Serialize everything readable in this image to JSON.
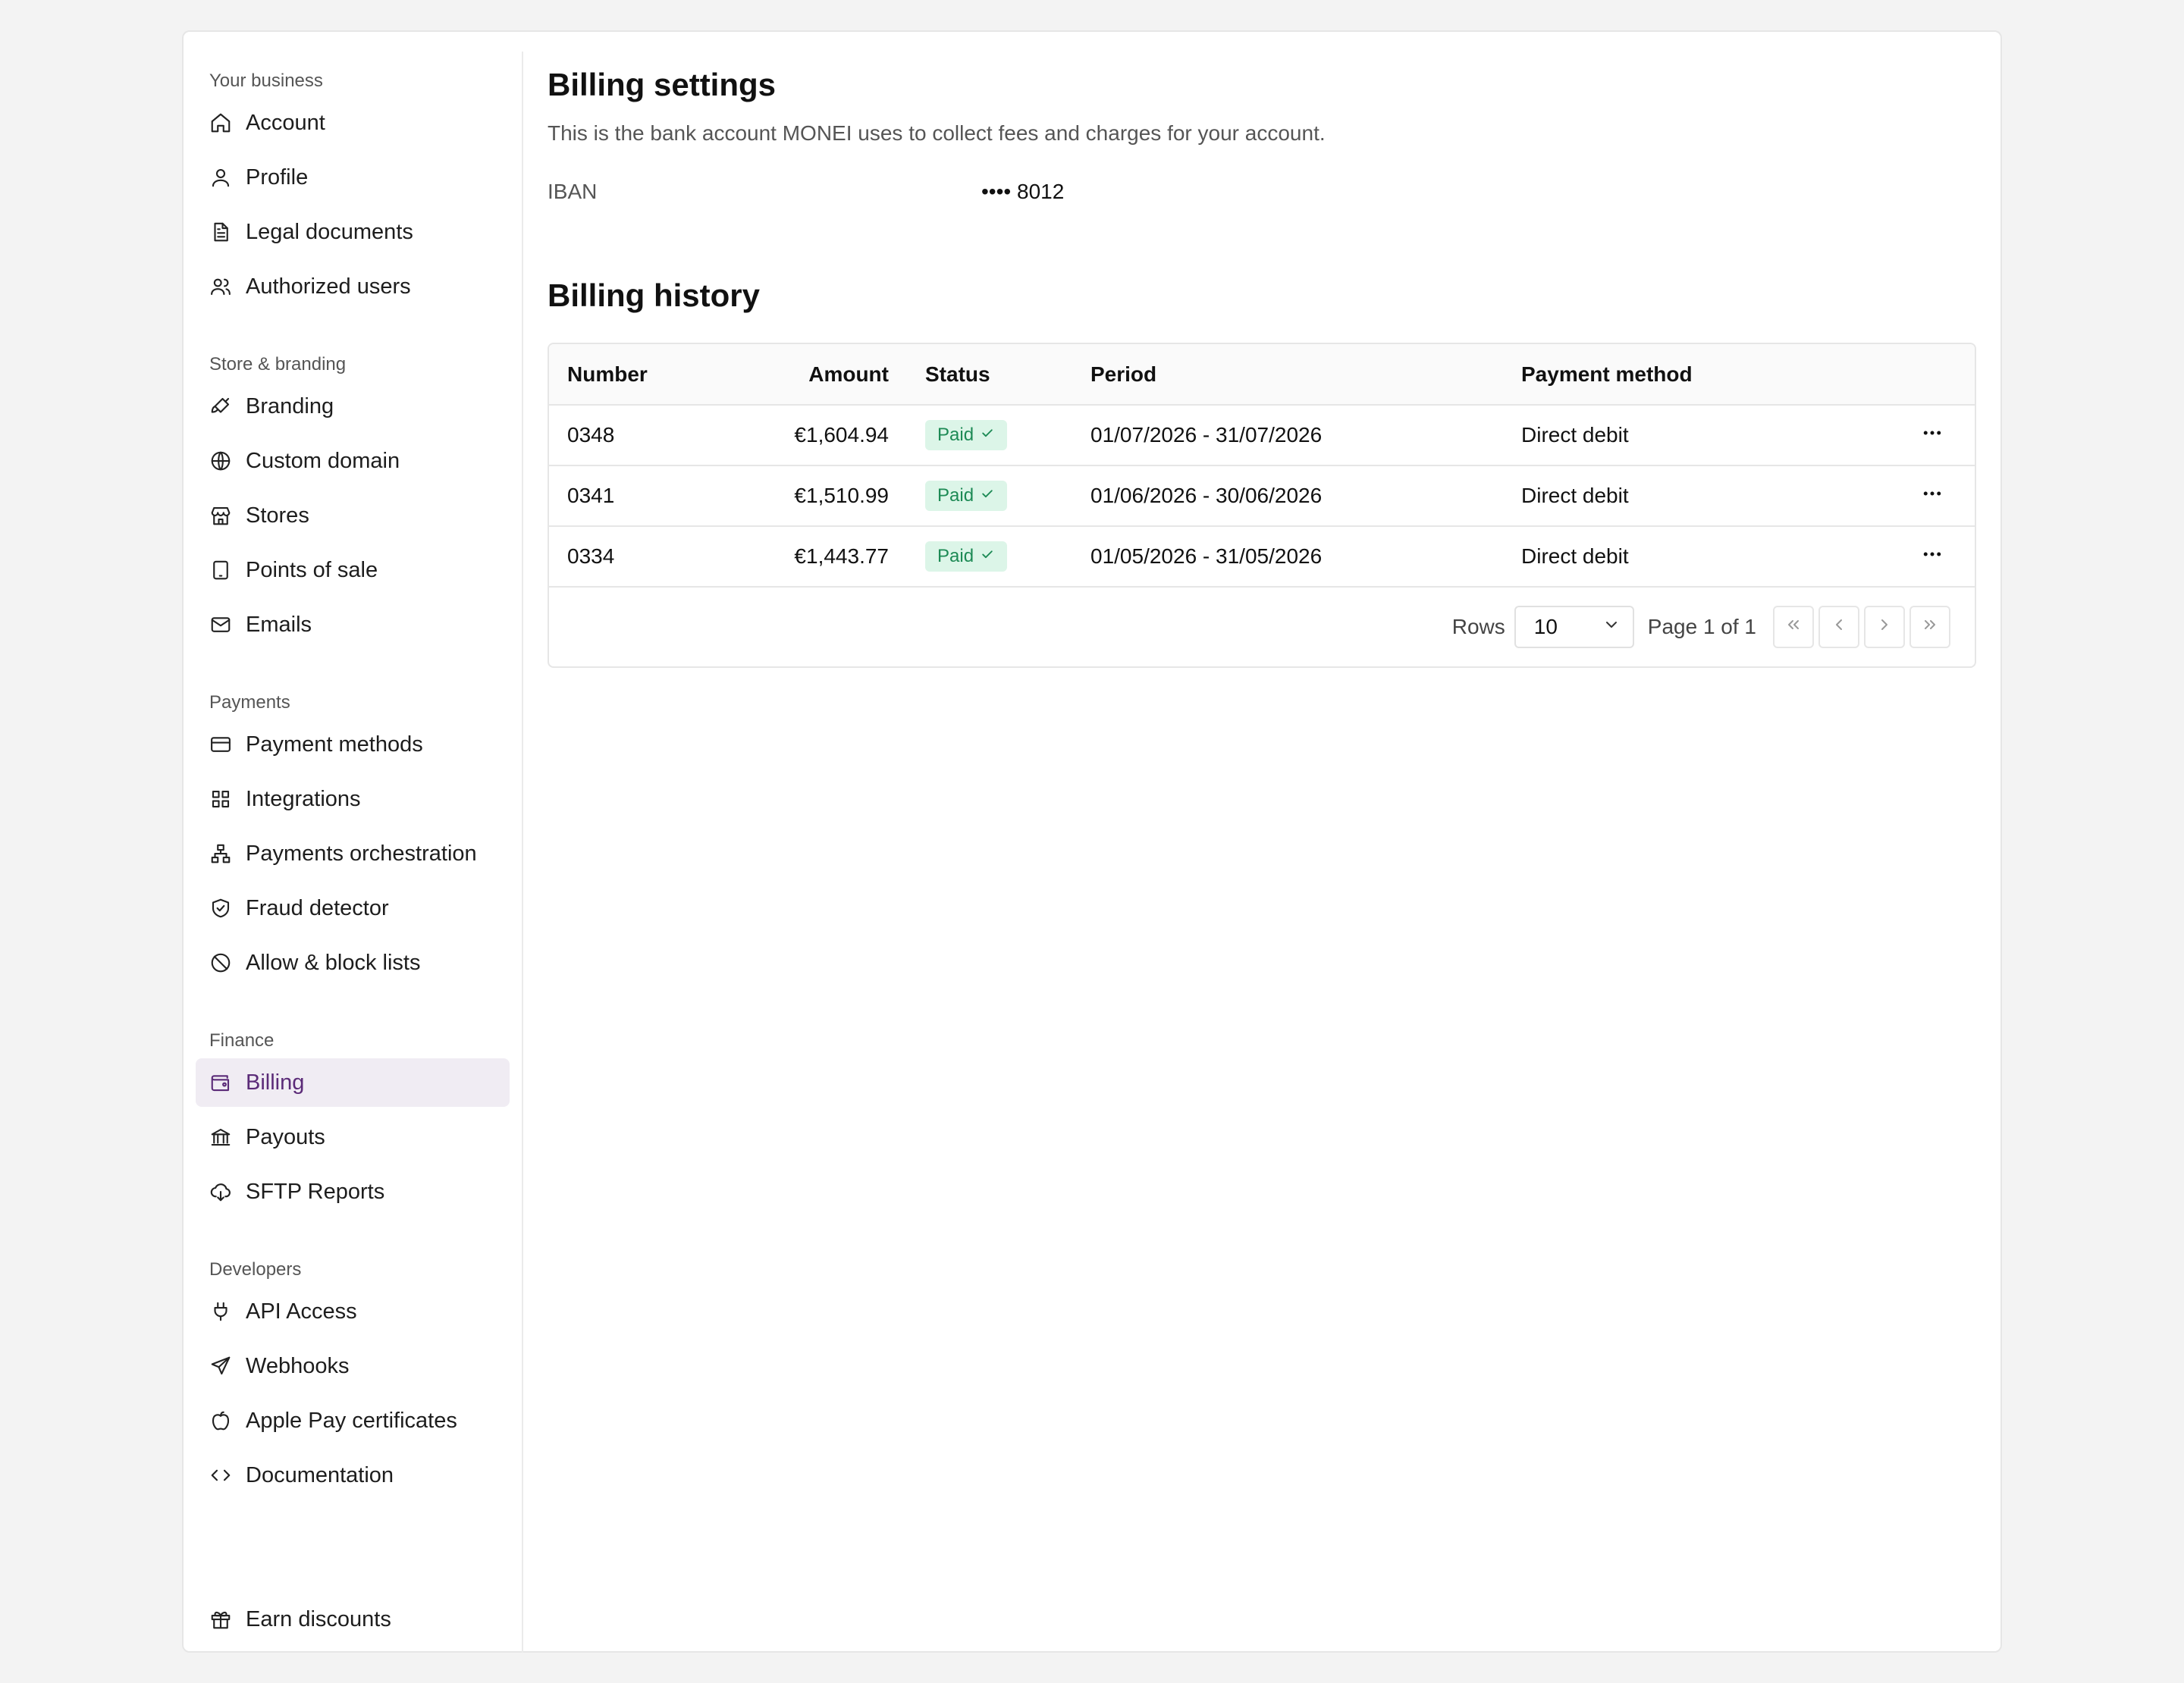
{
  "sidebar": {
    "sections": [
      {
        "title": "Your business",
        "items": [
          {
            "label": "Account",
            "icon": "home-icon"
          },
          {
            "label": "Profile",
            "icon": "user-icon"
          },
          {
            "label": "Legal documents",
            "icon": "document-icon"
          },
          {
            "label": "Authorized users",
            "icon": "users-icon"
          }
        ]
      },
      {
        "title": "Store & branding",
        "items": [
          {
            "label": "Branding",
            "icon": "paintbrush-icon"
          },
          {
            "label": "Custom domain",
            "icon": "globe-icon"
          },
          {
            "label": "Stores",
            "icon": "store-icon"
          },
          {
            "label": "Points of sale",
            "icon": "tablet-icon"
          },
          {
            "label": "Emails",
            "icon": "mail-icon"
          }
        ]
      },
      {
        "title": "Payments",
        "items": [
          {
            "label": "Payment methods",
            "icon": "credit-card-icon"
          },
          {
            "label": "Integrations",
            "icon": "grid-icon"
          },
          {
            "label": "Payments orchestration",
            "icon": "network-icon"
          },
          {
            "label": "Fraud detector",
            "icon": "shield-check-icon"
          },
          {
            "label": "Allow & block lists",
            "icon": "ban-icon"
          }
        ]
      },
      {
        "title": "Finance",
        "items": [
          {
            "label": "Billing",
            "icon": "wallet-icon",
            "active": true
          },
          {
            "label": "Payouts",
            "icon": "bank-icon"
          },
          {
            "label": "SFTP Reports",
            "icon": "cloud-download-icon"
          }
        ]
      },
      {
        "title": "Developers",
        "items": [
          {
            "label": "API Access",
            "icon": "plug-icon"
          },
          {
            "label": "Webhooks",
            "icon": "send-icon"
          },
          {
            "label": "Apple Pay certificates",
            "icon": "apple-icon"
          },
          {
            "label": "Documentation",
            "icon": "code-icon"
          }
        ]
      }
    ],
    "bottom_item": {
      "label": "Earn discounts",
      "icon": "gift-icon"
    }
  },
  "settings": {
    "title": "Billing settings",
    "subtitle": "This is the bank account MONEI uses to collect fees and charges for your account.",
    "iban_label": "IBAN",
    "iban_value": "•••• 8012"
  },
  "history": {
    "title": "Billing history",
    "columns": {
      "number": "Number",
      "amount": "Amount",
      "status": "Status",
      "period": "Period",
      "method": "Payment method"
    },
    "rows": [
      {
        "number": "0348",
        "amount": "€1,604.94",
        "status": "Paid",
        "period": "01/07/2026 - 31/07/2026",
        "method": "Direct debit"
      },
      {
        "number": "0341",
        "amount": "€1,510.99",
        "status": "Paid",
        "period": "01/06/2026 - 30/06/2026",
        "method": "Direct debit"
      },
      {
        "number": "0334",
        "amount": "€1,443.77",
        "status": "Paid",
        "period": "01/05/2026 - 31/05/2026",
        "method": "Direct debit"
      }
    ],
    "pagination": {
      "rows_label": "Rows",
      "rows_value": "10",
      "page_label": "Page 1 of 1"
    }
  },
  "colors": {
    "accent": "#5b2b78",
    "active_bg": "#f0ecf3",
    "paid_bg": "#dcf5e8",
    "paid_text": "#1d8a55"
  }
}
